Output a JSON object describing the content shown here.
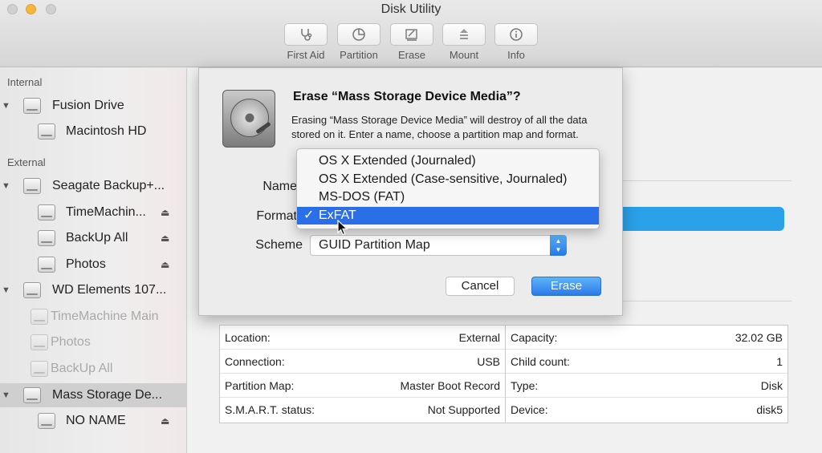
{
  "window": {
    "title": "Disk Utility"
  },
  "toolbar": [
    {
      "label": "First Aid",
      "icon": "stethoscope-icon"
    },
    {
      "label": "Partition",
      "icon": "pie-chart-icon"
    },
    {
      "label": "Erase",
      "icon": "erase-icon"
    },
    {
      "label": "Mount",
      "icon": "mount-icon"
    },
    {
      "label": "Info",
      "icon": "info-icon"
    }
  ],
  "sidebar": {
    "internal_label": "Internal",
    "external_label": "External",
    "items": [
      {
        "name": "Fusion Drive"
      },
      {
        "name": "Macintosh HD"
      },
      {
        "name": "Seagate Backup+..."
      },
      {
        "name": "TimeMachin..."
      },
      {
        "name": "BackUp All"
      },
      {
        "name": "Photos"
      },
      {
        "name": "WD Elements 107..."
      },
      {
        "name": "TimeMachine Main"
      },
      {
        "name": "Photos"
      },
      {
        "name": "BackUp All"
      },
      {
        "name": "Mass Storage De..."
      },
      {
        "name": "NO NAME"
      }
    ],
    "eject_glyph": "⏏",
    "expand_glyph": "▼"
  },
  "dialog": {
    "title": "Erase “Mass Storage Device Media”?",
    "message": "Erasing “Mass Storage Device Media” will destroy of all the data stored on it. Enter a name, choose a partition map and format.",
    "name_label": "Name",
    "format_label": "Format",
    "scheme_label": "Scheme",
    "scheme_value": "GUID Partition Map",
    "cancel_label": "Cancel",
    "erase_label": "Erase",
    "stepper_glyph": "▲▼"
  },
  "format_menu": {
    "options": [
      "OS X Extended (Journaled)",
      "OS X Extended (Case-sensitive, Journaled)",
      "MS-DOS (FAT)",
      "ExFAT"
    ],
    "selected_index": 3,
    "check_glyph": "✓"
  },
  "info_table": {
    "left": [
      {
        "key": "Location:",
        "value": "External"
      },
      {
        "key": "Connection:",
        "value": "USB"
      },
      {
        "key": "Partition Map:",
        "value": "Master Boot Record"
      },
      {
        "key": "S.M.A.R.T. status:",
        "value": "Not Supported"
      }
    ],
    "right": [
      {
        "key": "Capacity:",
        "value": "32.02 GB"
      },
      {
        "key": "Child count:",
        "value": "1"
      },
      {
        "key": "Type:",
        "value": "Disk"
      },
      {
        "key": "Device:",
        "value": "disk5"
      }
    ]
  },
  "colors": {
    "accent": "#2a6ee8",
    "usage_bar": "#2aa1e8",
    "traffic_orange": "#f5b63d"
  }
}
